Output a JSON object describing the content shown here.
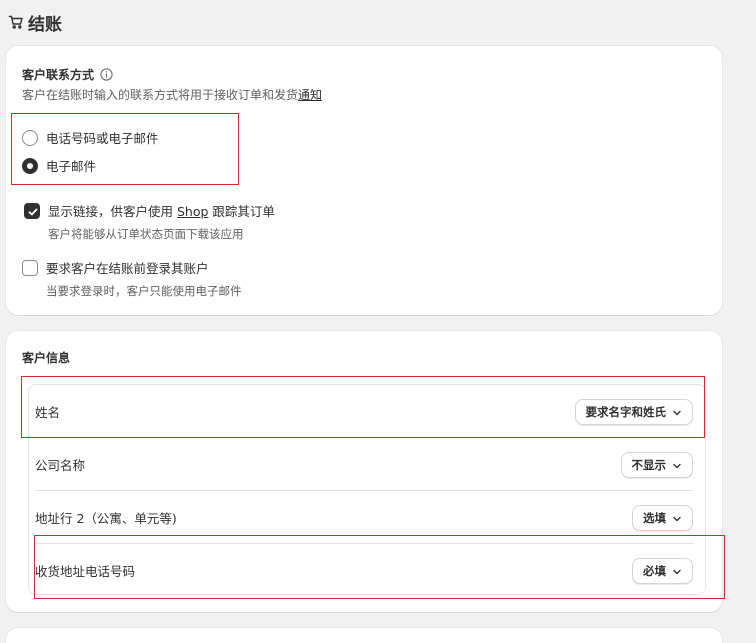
{
  "page": {
    "title": "结账",
    "icon": "cart-icon"
  },
  "contact": {
    "title": "客户联系方式",
    "desc_prefix": "客户在结账时输入的联系方式将用于接收订单和发货",
    "desc_link": "通知",
    "options": [
      {
        "label": "电话号码或电子邮件",
        "selected": false
      },
      {
        "label": "电子邮件",
        "selected": true
      }
    ],
    "show_link": {
      "label_prefix": "显示链接，供客户使用 ",
      "label_link": "Shop",
      "label_suffix": " 跟踪其订单",
      "help": "客户将能够从订单状态页面下载该应用",
      "checked": true
    },
    "require_login": {
      "label": "要求客户在结账前登录其账户",
      "help": "当要求登录时，客户只能使用电子邮件",
      "checked": false
    }
  },
  "customer_info": {
    "title": "客户信息",
    "fields": [
      {
        "label": "姓名",
        "value": "要求名字和姓氏"
      },
      {
        "label": "公司名称",
        "value": "不显示"
      },
      {
        "label": "地址行 2（公寓、单元等)",
        "value": "选填"
      },
      {
        "label": "收货地址电话号码",
        "value": "必填"
      }
    ]
  },
  "colors": {
    "highlight": "#d22c2c",
    "accent": "#303030",
    "background": "#f1f1f1"
  }
}
